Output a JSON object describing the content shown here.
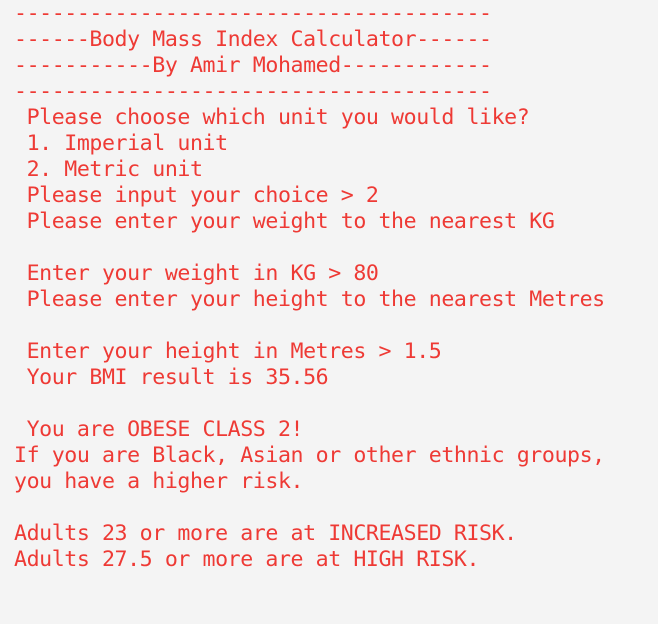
{
  "terminal": {
    "text_color": "#ee3a35",
    "background_color": "#f4f4f4",
    "lines": [
      "--------------------------------------",
      "------Body Mass Index Calculator------",
      "-----------By Amir Mohamed------------",
      "--------------------------------------",
      " Please choose which unit you would like?",
      " 1. Imperial unit",
      " 2. Metric unit",
      " Please input your choice > 2",
      " Please enter your weight to the nearest KG",
      "",
      " Enter your weight in KG > 80",
      " Please enter your height to the nearest Metres",
      "",
      " Enter your height in Metres > 1.5",
      " Your BMI result is 35.56",
      "",
      " You are OBESE CLASS 2!",
      "If you are Black, Asian or other ethnic groups,",
      "you have a higher risk.",
      "",
      "Adults 23 or more are at INCREASED RISK.",
      "Adults 27.5 or more are at HIGH RISK."
    ]
  }
}
